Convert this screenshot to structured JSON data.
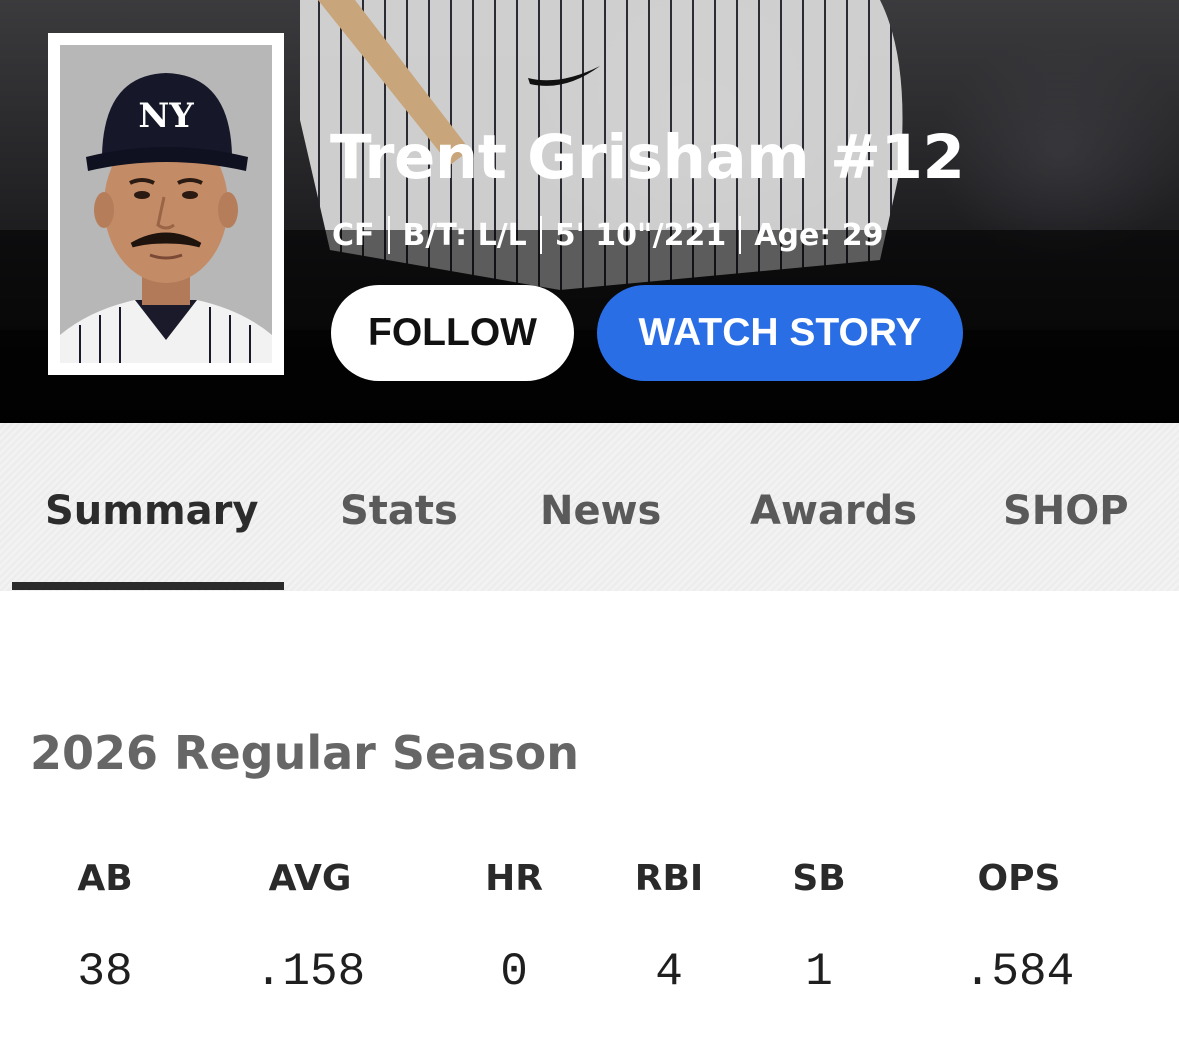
{
  "player": {
    "name": "Trent Grisham #12",
    "position": "CF",
    "bats_throws": "B/T: L/L",
    "height_weight": "5' 10\"/221",
    "age": "Age: 29",
    "cap_logo": "NY"
  },
  "actions": {
    "follow_label": "FOLLOW",
    "watch_story_label": "WATCH STORY"
  },
  "tabs": [
    {
      "label": "Summary",
      "active": true
    },
    {
      "label": "Stats",
      "active": false
    },
    {
      "label": "News",
      "active": false
    },
    {
      "label": "Awards",
      "active": false
    },
    {
      "label": "SHOP",
      "active": false
    }
  ],
  "season": {
    "title": "2026 Regular Season",
    "headers": [
      "AB",
      "AVG",
      "HR",
      "RBI",
      "SB",
      "OPS"
    ],
    "values": [
      "38",
      ".158",
      "0",
      "4",
      "1",
      ".584"
    ]
  },
  "colors": {
    "accent_blue": "#2a6ee6",
    "hero_dark": "#1d1d20",
    "tab_underline": "#2b2b2b"
  }
}
